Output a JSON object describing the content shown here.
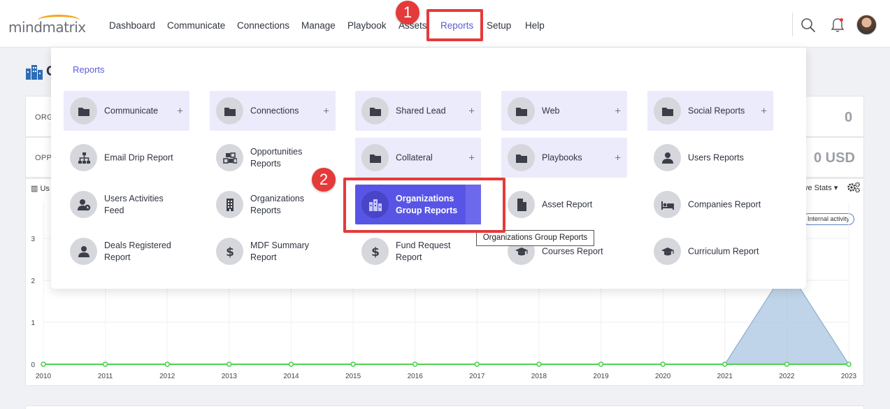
{
  "logo": {
    "text": "mindmatrix"
  },
  "nav": [
    {
      "label": "Dashboard",
      "x": 156
    },
    {
      "label": "Communicate",
      "x": 239
    },
    {
      "label": "Connections",
      "x": 339
    },
    {
      "label": "Manage",
      "x": 431
    },
    {
      "label": "Playbook",
      "x": 497
    },
    {
      "label": "Assets",
      "x": 570
    },
    {
      "label": "Reports",
      "x": 630,
      "active": true
    },
    {
      "label": "Setup",
      "x": 696
    },
    {
      "label": "Help",
      "x": 751
    }
  ],
  "background": {
    "page_title": "O",
    "row1_label": "ORG",
    "row1_value": "0",
    "row2_label": "OPP",
    "row2_value": "0 USD",
    "tab_label": "Us",
    "stats_label": "ve Stats",
    "internal_badge": "Internal activity",
    "chart_data": {
      "type": "area",
      "x": [
        "2010",
        "2011",
        "2012",
        "2013",
        "2014",
        "2015",
        "2016",
        "2017",
        "2018",
        "2019",
        "2020",
        "2021",
        "2022",
        "2023"
      ],
      "yticks": [
        "0",
        "1",
        "2",
        "3"
      ],
      "ylim": [
        0,
        3
      ],
      "series": [
        {
          "values": [
            0,
            0,
            0,
            0,
            0,
            0,
            0,
            0,
            0,
            0,
            0,
            0,
            0,
            0
          ],
          "color": "#4fd14f"
        },
        {
          "values": [
            0,
            0,
            0,
            0,
            0,
            0,
            0,
            0,
            0,
            0,
            0,
            0,
            2.3,
            0
          ],
          "color": "#a9c6e0"
        }
      ]
    }
  },
  "dropdown": {
    "header": "Reports",
    "tiles": [
      {
        "label": "Communicate",
        "icon": "folder",
        "folder": true,
        "plus": "+",
        "col": 0,
        "row": 0
      },
      {
        "label": "Connections",
        "icon": "folder",
        "folder": true,
        "plus": "+",
        "col": 1,
        "row": 0
      },
      {
        "label": "Shared Lead",
        "icon": "folder",
        "folder": true,
        "plus": "+",
        "col": 2,
        "row": 0
      },
      {
        "label": "Web",
        "icon": "folder",
        "folder": true,
        "plus": "+",
        "col": 3,
        "row": 0
      },
      {
        "label": "Social Reports",
        "icon": "folder",
        "folder": true,
        "plus": "+",
        "col": 4,
        "row": 0
      },
      {
        "label": "Email Drip Report",
        "icon": "sitemap",
        "col": 0,
        "row": 1
      },
      {
        "label": "Opportunities Reports",
        "icon": "cubes",
        "col": 1,
        "row": 1
      },
      {
        "label": "Collateral",
        "icon": "folder",
        "folder": true,
        "plus": "+",
        "col": 2,
        "row": 1
      },
      {
        "label": "Playbooks",
        "icon": "folder",
        "folder": true,
        "plus": "+",
        "col": 3,
        "row": 1
      },
      {
        "label": "Users Reports",
        "icon": "user",
        "col": 4,
        "row": 1
      },
      {
        "label": "Users Activities Feed",
        "icon": "user-clock",
        "col": 0,
        "row": 2
      },
      {
        "label": "Organizations Reports",
        "icon": "building",
        "col": 1,
        "row": 2
      },
      {
        "label": "Organizations Group Reports",
        "icon": "city",
        "selected": true,
        "col": 2,
        "row": 2
      },
      {
        "label": "Asset Report",
        "icon": "file",
        "col": 3,
        "row": 2
      },
      {
        "label": "Companies Report",
        "icon": "bed",
        "col": 4,
        "row": 2
      },
      {
        "label": "Deals Registered Report",
        "icon": "user",
        "col": 0,
        "row": 3
      },
      {
        "label": "MDF Summary Report",
        "icon": "dollar",
        "col": 1,
        "row": 3
      },
      {
        "label": "Fund Request Report",
        "icon": "dollar",
        "col": 2,
        "row": 3
      },
      {
        "label": "Courses Report",
        "icon": "graduation-cap",
        "col": 3,
        "row": 3
      },
      {
        "label": "Curriculum Report",
        "icon": "graduation-cap",
        "col": 4,
        "row": 3
      }
    ],
    "tooltip": "Organizations Group Reports"
  },
  "annotations": [
    {
      "number": "1"
    },
    {
      "number": "2"
    }
  ]
}
